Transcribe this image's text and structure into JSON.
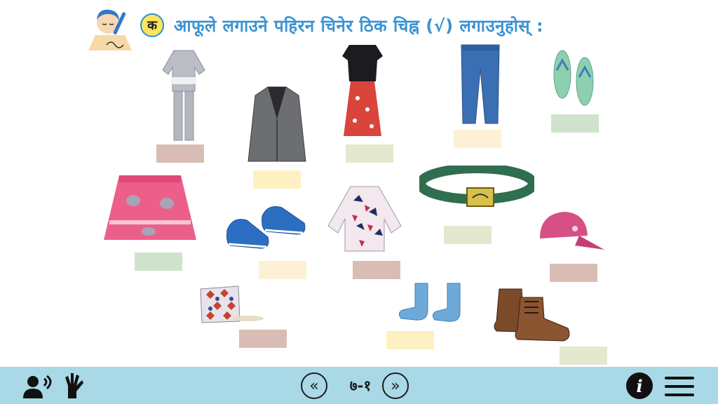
{
  "header": {
    "badge": "क",
    "instruction": "आफूले लगाउने पहिरन चिनेर ठिक चिह्न (√) लगाउनुहोस् :"
  },
  "icons": {
    "writing_child": "writing-child-icon",
    "audio": "speaker-person-icon",
    "sign_language": "sign-language-hand-icon",
    "prev": "double-chevron-left-icon",
    "next": "double-chevron-right-icon",
    "info": "info-icon",
    "menu": "hamburger-menu-icon"
  },
  "items": [
    {
      "name": "kurta-suruwal",
      "box_color": "#d9bdb5"
    },
    {
      "name": "coat",
      "box_color": "#fdf1c1"
    },
    {
      "name": "blouse-and-skirt",
      "box_color": "#e3e8cf"
    },
    {
      "name": "jeans",
      "box_color": "#fdf0d5"
    },
    {
      "name": "slippers",
      "box_color": "#cfe3cc"
    },
    {
      "name": "pink-skirt",
      "box_color": "#cfe3cc"
    },
    {
      "name": "sneakers",
      "box_color": "#fdf0d5"
    },
    {
      "name": "printed-shirt",
      "box_color": "#d9bdb5"
    },
    {
      "name": "belt",
      "box_color": "#e3e8cf"
    },
    {
      "name": "cap",
      "box_color": "#d9bdb5"
    },
    {
      "name": "dhaka-topi",
      "box_color": "#d9bdb5"
    },
    {
      "name": "socks",
      "box_color": "#fdf1c1"
    },
    {
      "name": "boots",
      "box_color": "#e3e8cf"
    }
  ],
  "footer": {
    "page": "७-१",
    "prev_symbol": "«",
    "next_symbol": "»",
    "info_symbol": "i"
  },
  "colors": {
    "toolbar": "#a9d9e7",
    "instruction_text": "#3a92d2",
    "badge_fill": "#fbe55c"
  }
}
